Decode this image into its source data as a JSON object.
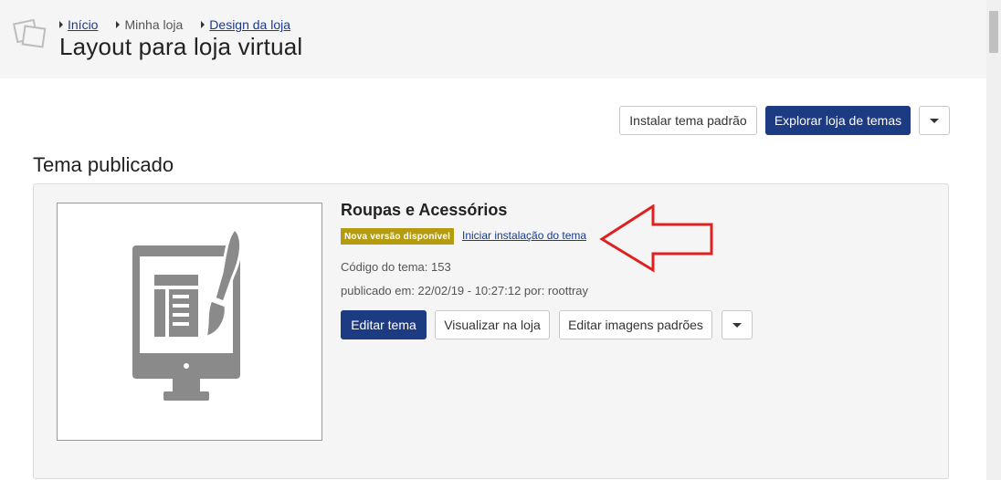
{
  "header": {
    "breadcrumb": [
      {
        "label": "Início",
        "link": true
      },
      {
        "label": "Minha loja",
        "link": false
      },
      {
        "label": "Design da loja",
        "link": true
      }
    ],
    "title": "Layout para loja virtual",
    "logo_icon": "stacked-pages-icon"
  },
  "actions": {
    "install_default": "Instalar tema padrão",
    "explore_store": "Explorar loja de temas",
    "more_icon": "caret-down-icon"
  },
  "published": {
    "section_title": "Tema publicado",
    "theme_name": "Roupas e Acessórios",
    "badge": "Nova versão disponível",
    "install_link": "Iniciar instalação do tema",
    "code": "Código do tema: 153",
    "published_at": "publicado em: 22/02/19 - 10:27:12 por: roottray",
    "buttons": {
      "edit": "Editar tema",
      "view": "Visualizar na loja",
      "edit_images": "Editar imagens padrões"
    },
    "thumbnail_icon": "monitor-paintbrush-icon"
  },
  "colors": {
    "primary": "#1d3b82",
    "badge": "#b59b10",
    "annotation_arrow": "#e02020"
  }
}
